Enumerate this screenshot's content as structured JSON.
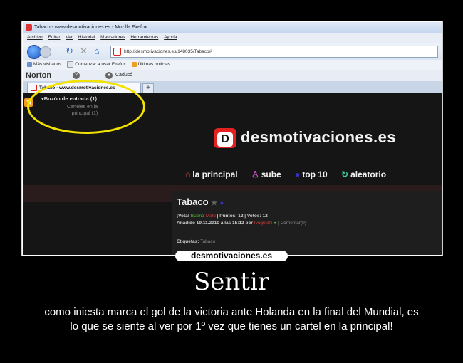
{
  "browser": {
    "window_title": "Tabaco - www.desmotivaciones.es - Mozilla Firefox",
    "menu": [
      "Archivo",
      "Editar",
      "Ver",
      "Historial",
      "Marcadores",
      "Herramientas",
      "Ayuda"
    ],
    "url": "http://desmotivaciones.es/148035/Tabaco#",
    "bookmarks": [
      "Más visitados",
      "Comenzar a usar Firefox",
      "Últimas noticias"
    ],
    "norton": {
      "brand": "Norton",
      "status": "Caducó"
    },
    "tab_label": "Tabaco - www.desmotivaciones.es",
    "new_tab": "+"
  },
  "page": {
    "inbox_label": "▾Buzón de entrada (1)",
    "inbox_sub1": "Carteles en la",
    "inbox_sub2": "principal (1)",
    "logo_letter": "D",
    "logo_text": "desmotivaciones.es",
    "nav": [
      {
        "icon": "⌂",
        "label": "la principal"
      },
      {
        "icon": "♙",
        "label": "sube"
      },
      {
        "icon": "●",
        "label": "top 10"
      },
      {
        "icon": "↻",
        "label": "aleatorio"
      }
    ],
    "post": {
      "title": "Tabaco",
      "vote_label": "¡Vota!",
      "vote_up": "Bueno",
      "vote_sep": "·",
      "vote_down": "Malo",
      "points": "| Puntos: 12 | Votos: 12",
      "added_prefix": "Añadido 19.11.2010 a las 15:12 por",
      "author": "Ivoguichi",
      "comment": "| Comentar(0)",
      "tags_label": "Etiquetas:",
      "tags_value": "Tabaco"
    }
  },
  "poster": {
    "watermark": "desmotivaciones.es",
    "title": "Sentir",
    "caption": "como iniesta marca el gol de la victoria ante Holanda en la final del Mundial, es lo que se  siente al ver por 1º vez que tienes un cartel en la principal!"
  },
  "colors": {
    "highlight_ellipse": "#f2e200",
    "logo_red": "#e52020",
    "background": "#000000"
  }
}
